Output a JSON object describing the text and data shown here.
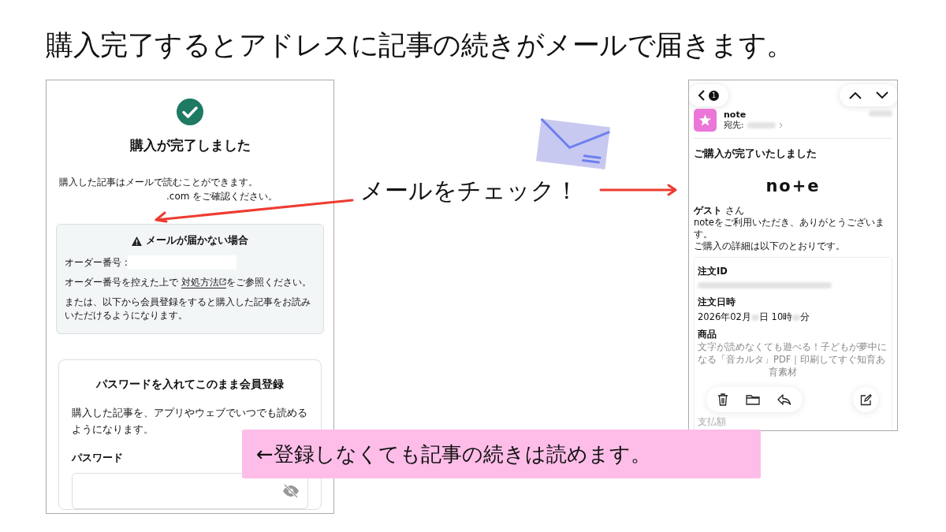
{
  "headline": "購入完了するとアドレスに記事の続きがメールで届きます。",
  "purchase_page": {
    "title": "購入が完了しました",
    "message_lines": [
      "購入した記事はメールで読むことができます。",
      ".com をご確認ください。"
    ],
    "notice": {
      "title": "メールが届かない場合",
      "order_label": "オーダー番号 :",
      "guide_before": "オーダー番号を控えた上で ",
      "guide_link": "対処方法",
      "guide_after": "をご参照ください。",
      "member_text": "または、以下から会員登録をすると購入した記事をお読みいただけるようになります。"
    },
    "register": {
      "title": "パスワードを入れてこのまま会員登録",
      "text": "購入した記事を、アプリやウェブでいつでも読めるようになります。",
      "password_label": "パスワード"
    }
  },
  "callout": "メールをチェック！",
  "email": {
    "back_badge": "1",
    "sender": "note",
    "to_label": "宛先:",
    "subject": "ご購入が完了いたしました",
    "logo": "no+e",
    "greeting_name": "ゲスト",
    "greeting_suffix": " さん",
    "body_lines": [
      "noteをご利用いただき、ありがとうございます。",
      "ご購入の詳細は以下のとおりです。"
    ],
    "order_id_label": "注文ID",
    "date_label": "注文日時",
    "date_parts": [
      "2026年02月",
      "日 10時",
      "分"
    ],
    "product_label": "商品",
    "product_lines": [
      "文字が読めなくても遊べる！子どもが夢中に",
      "なる「音カルタ」PDF｜印刷してすぐ知育あ",
      "育素材"
    ],
    "payment_label": "支払額"
  },
  "banner": "←登録しなくても記事の続きは読めます。"
}
